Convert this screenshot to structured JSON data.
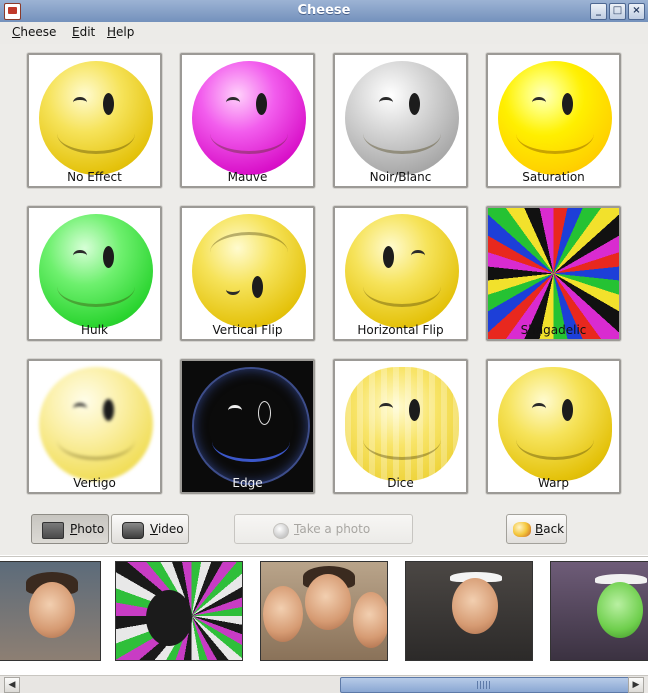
{
  "window": {
    "title": "Cheese"
  },
  "menu": [
    "Cheese",
    "Edit",
    "Help"
  ],
  "effects": [
    {
      "label": "No Effect"
    },
    {
      "label": "Mauve"
    },
    {
      "label": "Noir/Blanc"
    },
    {
      "label": "Saturation"
    },
    {
      "label": "Hulk"
    },
    {
      "label": "Vertical Flip"
    },
    {
      "label": "Horizontal Flip"
    },
    {
      "label": "Shagadelic"
    },
    {
      "label": "Vertigo"
    },
    {
      "label": "Edge"
    },
    {
      "label": "Dice"
    },
    {
      "label": "Warp"
    }
  ],
  "controls": {
    "photo": "Photo",
    "video": "Video",
    "take_photo": "Take a photo",
    "back": "Back"
  },
  "thumbnails": [
    "photo-1",
    "photo-2",
    "photo-3",
    "photo-4",
    "photo-5"
  ],
  "colors": {
    "titlebar": "#7f9bc6",
    "panel": "#edece9",
    "scroll_thumb": "#9ab4db"
  }
}
